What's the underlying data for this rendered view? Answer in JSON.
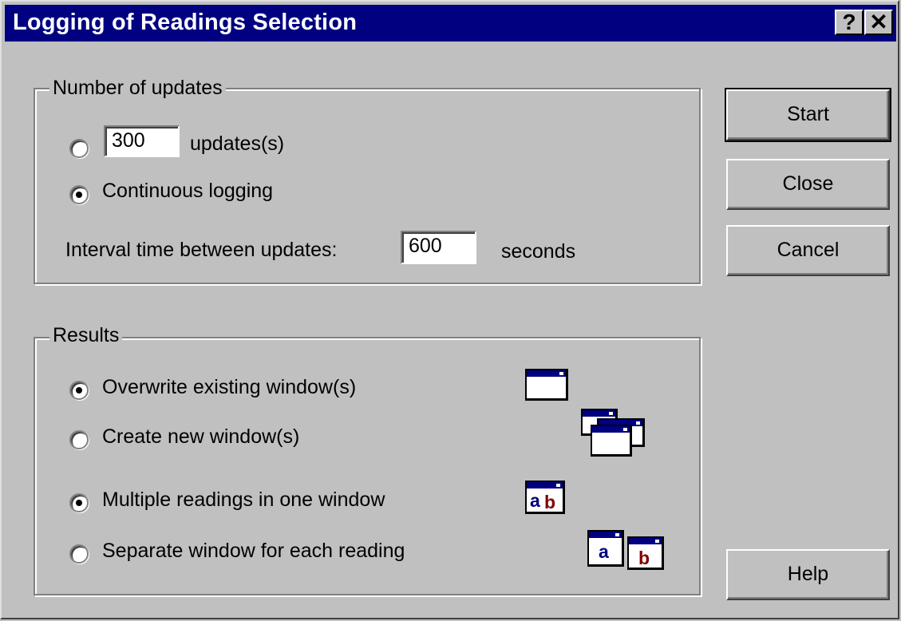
{
  "window": {
    "title": "Logging of Readings Selection",
    "help_glyph": "?",
    "close_glyph": "✕"
  },
  "updates_group": {
    "legend": "Number of updates",
    "count_option": {
      "selected": false,
      "value": "300",
      "suffix": "updates(s)"
    },
    "continuous_option": {
      "selected": true,
      "label": "Continuous logging"
    },
    "interval": {
      "label": "Interval time between updates:",
      "value": "600",
      "unit": "seconds"
    }
  },
  "results_group": {
    "legend": "Results",
    "overwrite": {
      "selected": true,
      "label": "Overwrite existing window(s)",
      "icon": "single-window-icon"
    },
    "create_new": {
      "selected": false,
      "label": "Create new window(s)",
      "icon": "stacked-windows-icon"
    },
    "multiple": {
      "selected": true,
      "label": "Multiple readings in one window",
      "icon": "ab-window-icon"
    },
    "separate": {
      "selected": false,
      "label": "Separate window for each reading",
      "icon": "a-b-windows-icon"
    },
    "icon_letters": {
      "ab_a": "a",
      "ab_b": "b",
      "sep_a": "a",
      "sep_b": "b"
    }
  },
  "buttons": {
    "start": "Start",
    "close": "Close",
    "cancel": "Cancel",
    "help": "Help"
  },
  "colors": {
    "title_bar": "#000080",
    "face": "#c0c0c0",
    "icon_letter_a": "#000080",
    "icon_letter_b": "#800000"
  }
}
